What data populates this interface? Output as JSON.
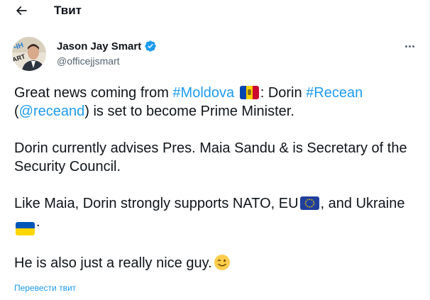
{
  "header": {
    "title": "Твит"
  },
  "author": {
    "display_name": "Jason Jay Smart",
    "handle": "@officejjsmart"
  },
  "tweet": {
    "p1": {
      "t1": "Great news coming from ",
      "hashtag1": "#Moldova",
      "t2": ": Dorin ",
      "hashtag2": "#Recean",
      "t3": "(",
      "mention": "@receand",
      "t4": ") is set to become Prime Minister."
    },
    "p2": "Dorin currently advises Pres. Maia Sandu & is Secretary of the Security Council.",
    "p3": {
      "t1": "Like Maia, Dorin strongly supports NATO, EU",
      "t2": ", and Ukraine",
      "t3": "."
    },
    "p4": "He is also just a really nice guy."
  },
  "translate_label": "Перевести твит",
  "icons": {
    "back": "back-arrow-icon",
    "verified": "verified-badge-icon",
    "more": "more-options-icon",
    "flag_moldova": "moldova-flag-emoji",
    "flag_eu": "eu-flag-emoji",
    "flag_ukraine": "ukraine-flag-emoji",
    "wink": "winking-face-emoji"
  },
  "colors": {
    "link": "#1d9bf0",
    "text": "#0f1419",
    "secondary": "#536471",
    "verified": "#1d9bf0"
  }
}
